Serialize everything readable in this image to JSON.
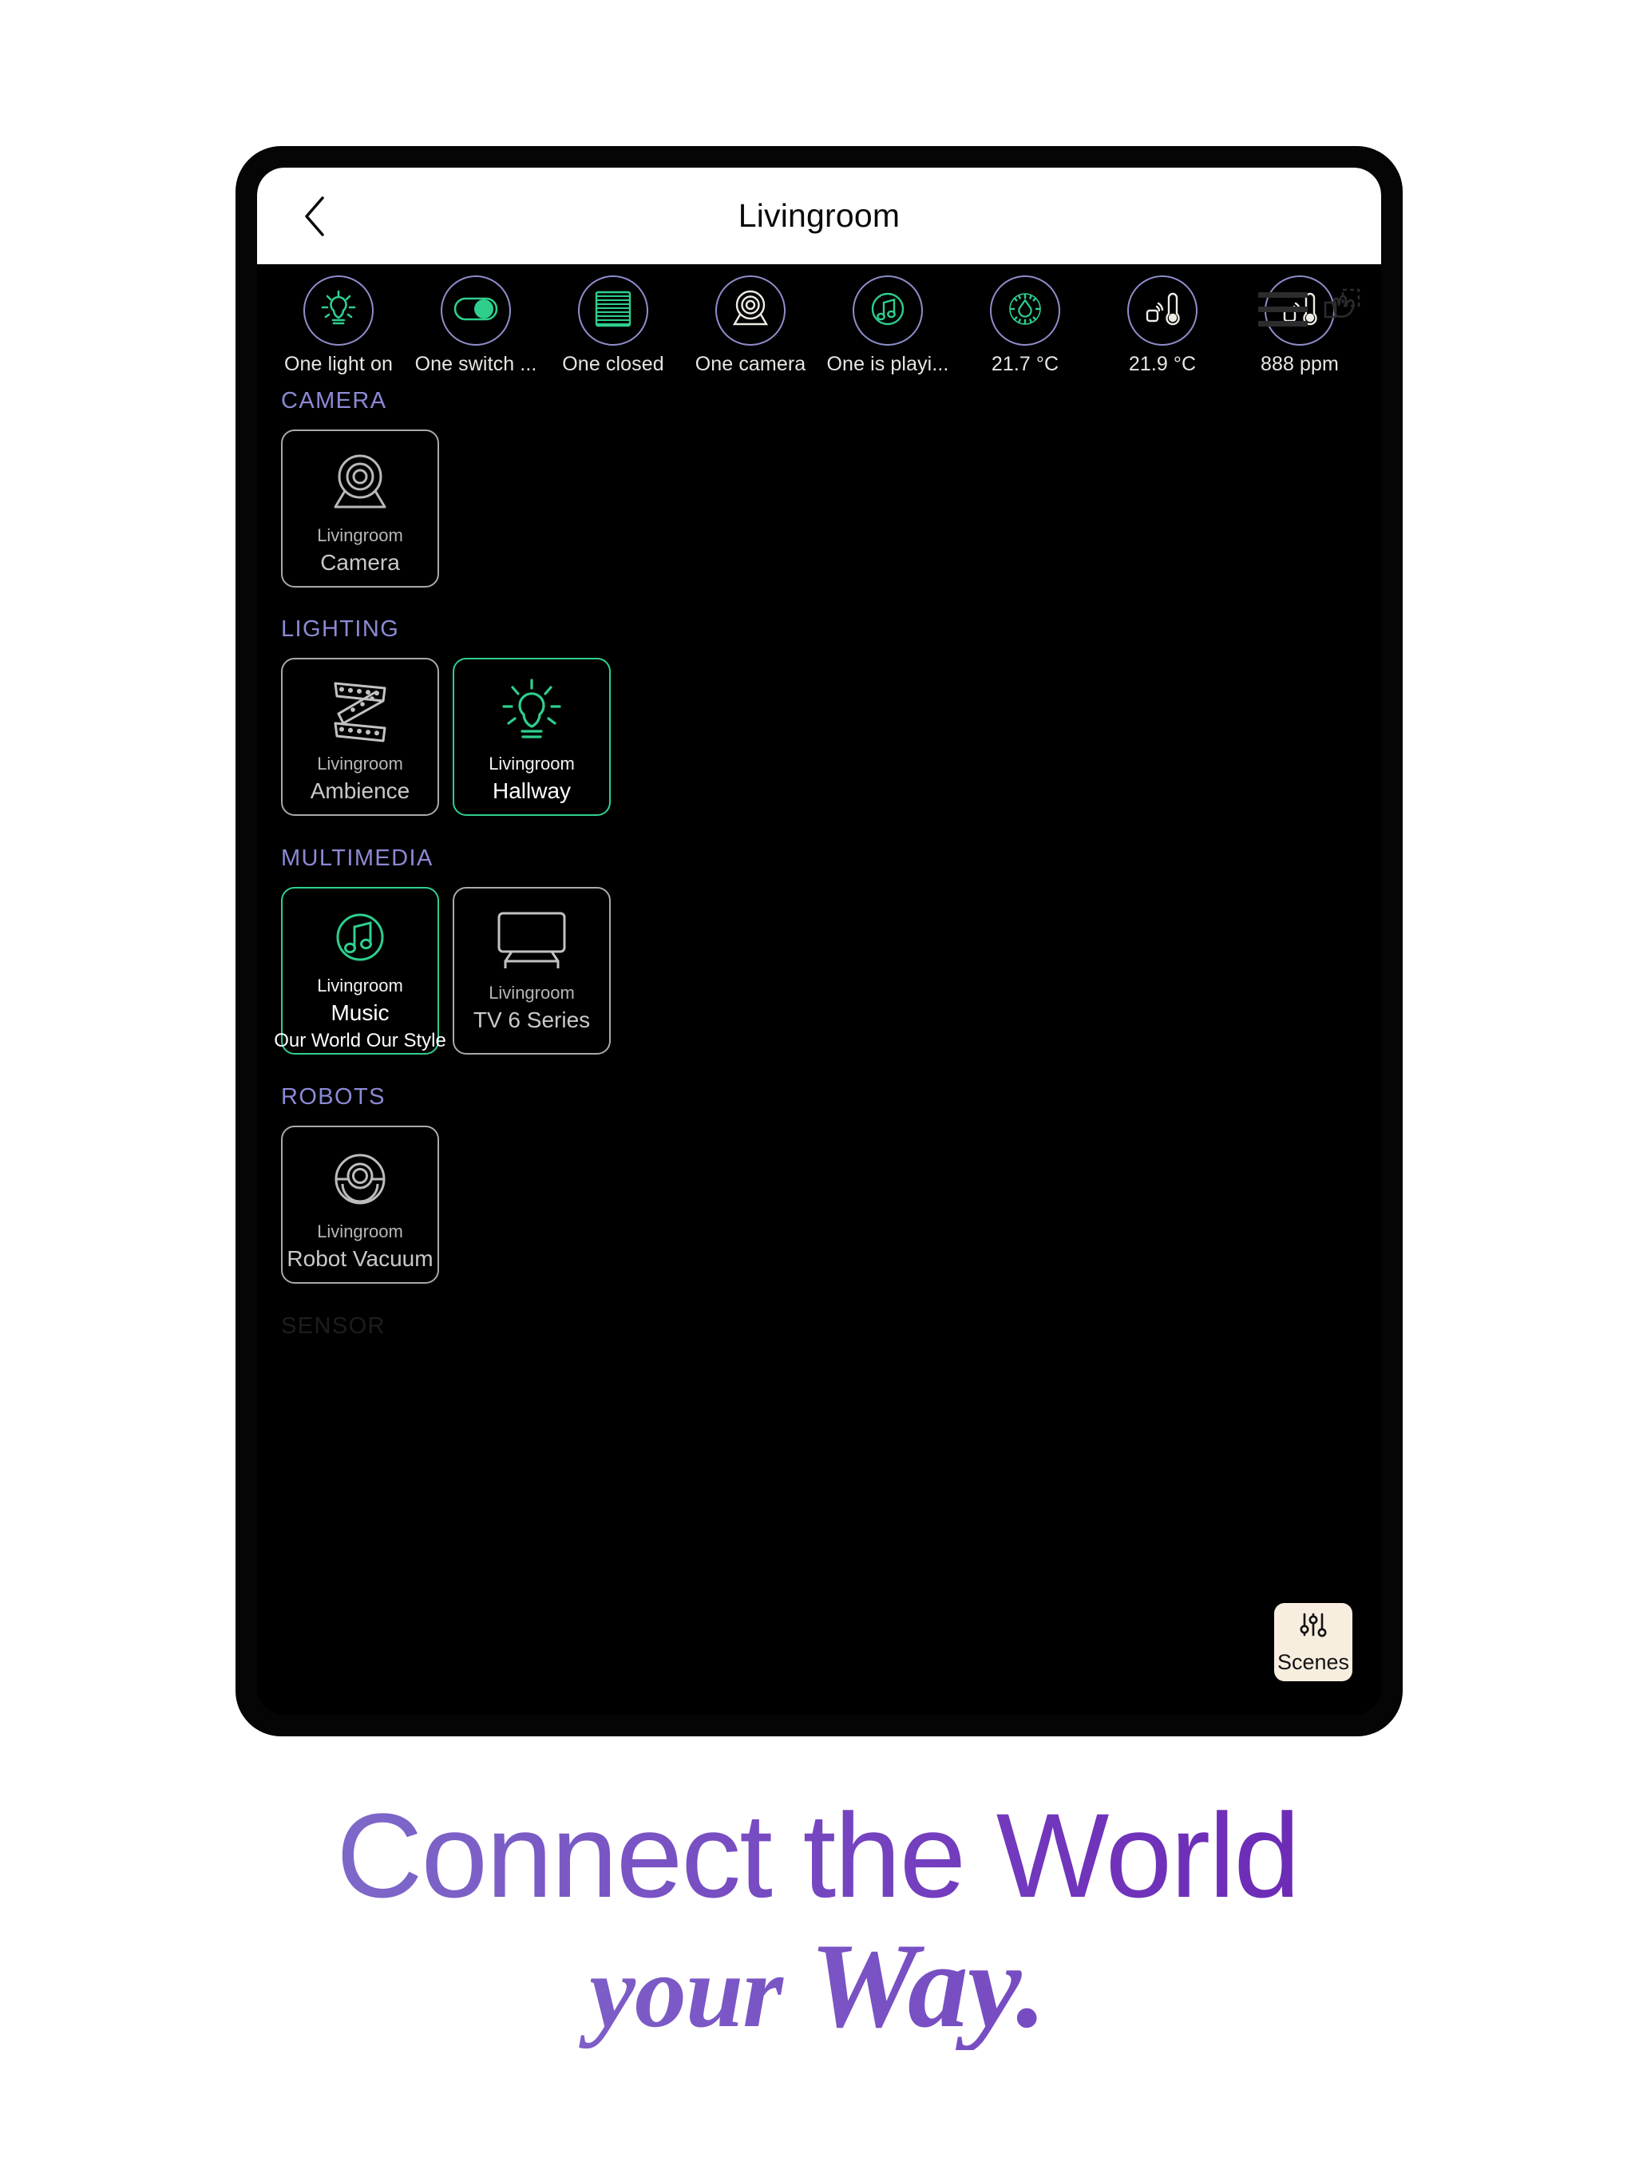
{
  "header": {
    "title": "Livingroom",
    "back_icon": "chevron-left-icon",
    "menu_icon": "hamburger-menu-icon",
    "edit_icon": "drag-hand-icon"
  },
  "status_strip": [
    {
      "id": "light",
      "icon": "light-bulb-icon",
      "label": "One light on",
      "unit": "",
      "state": "on"
    },
    {
      "id": "switch",
      "icon": "toggle-switch-icon",
      "label": "One switch ...",
      "unit": "",
      "state": "on"
    },
    {
      "id": "cover",
      "icon": "blinds-icon",
      "label": "One closed",
      "unit": "",
      "state": "on"
    },
    {
      "id": "camera",
      "icon": "webcam-icon",
      "label": "One camera",
      "unit": "",
      "state": "off"
    },
    {
      "id": "media",
      "icon": "music-note-icon",
      "label": "One is playi...",
      "unit": "",
      "state": "on"
    },
    {
      "id": "humidity",
      "icon": "humidity-dial-icon",
      "label": "21.7",
      "unit": "°C",
      "state": "on"
    },
    {
      "id": "temp",
      "icon": "thermometer-icon",
      "label": "21.9",
      "unit": "°C",
      "state": "off"
    },
    {
      "id": "co2",
      "icon": "thermometer-icon",
      "label": "888",
      "unit": "ppm",
      "state": "off"
    }
  ],
  "sections": [
    {
      "title": "CAMERA",
      "dim": false,
      "cards": [
        {
          "icon": "webcam-icon",
          "room": "Livingroom",
          "name": "Camera",
          "sub": "",
          "active": false,
          "tall": false
        }
      ]
    },
    {
      "title": "LIGHTING",
      "dim": false,
      "cards": [
        {
          "icon": "led-strip-icon",
          "room": "Livingroom",
          "name": "Ambience",
          "sub": "",
          "active": false,
          "tall": false
        },
        {
          "icon": "light-bulb-icon",
          "room": "Livingroom",
          "name": "Hallway",
          "sub": "",
          "active": true,
          "tall": false
        }
      ]
    },
    {
      "title": "MULTIMEDIA",
      "dim": false,
      "cards": [
        {
          "icon": "music-circle-icon",
          "room": "Livingroom",
          "name": "Music",
          "sub": "Our World Our Style",
          "active": true,
          "tall": true
        },
        {
          "icon": "television-icon",
          "room": "Livingroom",
          "name": "TV 6 Series",
          "sub": "",
          "active": false,
          "tall": true
        }
      ]
    },
    {
      "title": "ROBOTS",
      "dim": false,
      "cards": [
        {
          "icon": "robot-vacuum-icon",
          "room": "Livingroom",
          "name": "Robot Vacuum",
          "sub": "",
          "active": false,
          "tall": false
        }
      ]
    },
    {
      "title": "SENSOR",
      "dim": true,
      "cards": []
    }
  ],
  "scenes_button": {
    "label": "Scenes",
    "icon": "sliders-icon"
  },
  "tagline": {
    "line1": "Connect the World",
    "line2_italic": "your",
    "line2_rest": "Way."
  },
  "colors": {
    "accent_green": "#2ecf8d",
    "accent_periwinkle": "#8b8ad4",
    "circle_ring": "#8e8ecb",
    "card_border": "#a9a9a9",
    "scenes_bg": "#f7eedf",
    "screen_bg": "#000000",
    "header_bg": "#ffffff",
    "tagline_start": "#8180cf",
    "tagline_end": "#661bae"
  }
}
